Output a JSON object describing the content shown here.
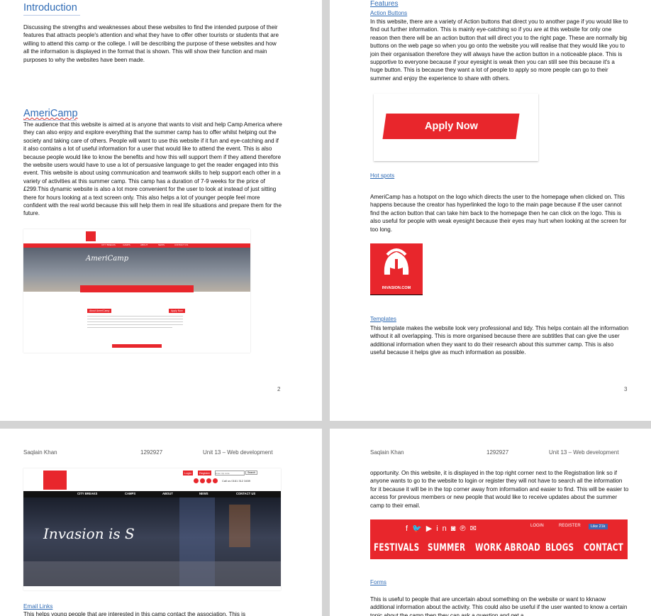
{
  "page2": {
    "heading_intro": "Introduction",
    "intro_text": "Discussing the strengths and weaknesses about these websites to find the intended purpose of their features that attracts people's attention and what they have to offer other tourists or students that are willing to attend this camp or the college. I will be describing the purpose of these websites and how all the information is displayed in the format that is shown. This will show their function and main purposes to why the websites have been made.",
    "heading_americamp": "AmeriCamp",
    "americamp_text": "The audience that this website is aimed at is anyone that wants to visit and help Camp America where they can also enjoy and explore everything that the summer camp has to offer whilst helping out the society and taking care of others. People will want to use this website if it fun and eye-catching and if it also contains a lot of useful information for a user that would like to attend the event. This is also because people would like to know the benefits and how this will support them if they attend therefore the website users would have to use a lot of persuasive language to get the reader engaged into this event. This website is about using communication and teamwork skills to help support each other in a variety of activities at this summer camp. This camp has a duration of 7-9 weeks for the price of £299.This dynamic website is also a lot more convenient for the user to look at instead of just sitting there for hours looking at a text screen only. This also helps a lot of younger people feel more confident with the real world because this will help them in real life situations and prepare them for the future.",
    "page_number": "2",
    "screenshot": {
      "nav": [
        "CITY BREAKS",
        "CAMPS",
        "ABOUT",
        "NEWS",
        "CONTACT US"
      ],
      "hero_text": "AmeriCamp",
      "about_label": "About AmeriCamp",
      "apply_label": "Apply Now"
    }
  },
  "page3": {
    "heading_features": "Features",
    "sub_action_buttons": "Action Buttons",
    "action_text": "In this website, there are a variety of Action buttons that direct you to another page if you would like to find out further information. This is mainly eye-catching so if you are at this website for only one reason then there will be an action button that will direct you to the right page. These are normally big buttons on the web page so when you go onto the website you will realise that they would like you to join their organisation therefore they will always have the action button in a noticeable place. This is supportive to everyone because if your eyesight is weak then you can still see this because it's a huge button. This is because they want a lot of people to apply so more people can go to their summer and enjoy the experience to share with others.",
    "apply_now_label": "Apply Now",
    "sub_hot_spots": "Hot spots",
    "hotspot_text": "AmeriCamp has a hotspot on the logo which directs the user to the homepage when clicked on. This happens because the creator has hyperlinked the logo to the main page because if the user cannot find the action button that can take him back to the homepage then he can click on the logo. This is also useful for people with weak eyesight because their eyes may hurt when looking at the screen for too long.",
    "invasion_logo_text": "INVASION.COM",
    "sub_templates": "Templates",
    "templates_text": "This template makes the website look very professional and tidy. This helps contain all the information without it all overlapping. This is more organised because there are subtitles that can give the user additional information when they want to do their research about this summer camp. This is also useful because it helps give as much information as possible.",
    "page_number": "3"
  },
  "page4": {
    "header_name": "Saqlain Khan",
    "header_id": "1292927",
    "header_unit": "Unit 13 – Web development",
    "screenshot": {
      "login": "Login",
      "register": "Register",
      "search_placeholder": "Enter trip code",
      "search_button": "Search",
      "phone": "Call us 0161 312 3459",
      "nav": [
        "CITY BREAKS",
        "CAMPS",
        "ABOUT",
        "NEWS",
        "CONTACT US"
      ],
      "tagline": "Invasion is S"
    },
    "sub_email_links": "Email Links",
    "email_text": "This helps young people that are interested in this camp contact the association. This is"
  },
  "page5": {
    "header_name": "Saqlain Khan",
    "header_id": "1292927",
    "header_unit": "Unit 13 – Web development",
    "cont_text": "opportunity. On this website, it is displayed in the top right corner next to the Registration link so if anyone wants to go to the website to login or register they will not have to search all the information for it because it will be in the top corner away from information and easier to find. This will be easier to access for previous members or new people that would like to receive updates about the summer camp to their email.",
    "nav_login": "LOGIN",
    "nav_register": "REGISTER",
    "nav_like": "Like 21k",
    "nav_menu": [
      "FESTIVALS",
      "SUMMER",
      "WORK ABROAD",
      "BLOGS",
      "CONTACT"
    ],
    "sub_forms": "Forms",
    "forms_text": "This is useful to people that are uncertain about something on the website or want to kknaow additional information about the activity. This could also be useful if the user wanted to know a certain topic about the camp then they can ask a question and get a"
  },
  "colors": {
    "accent": "#2f6bb5",
    "brand_red": "#e8262c"
  }
}
